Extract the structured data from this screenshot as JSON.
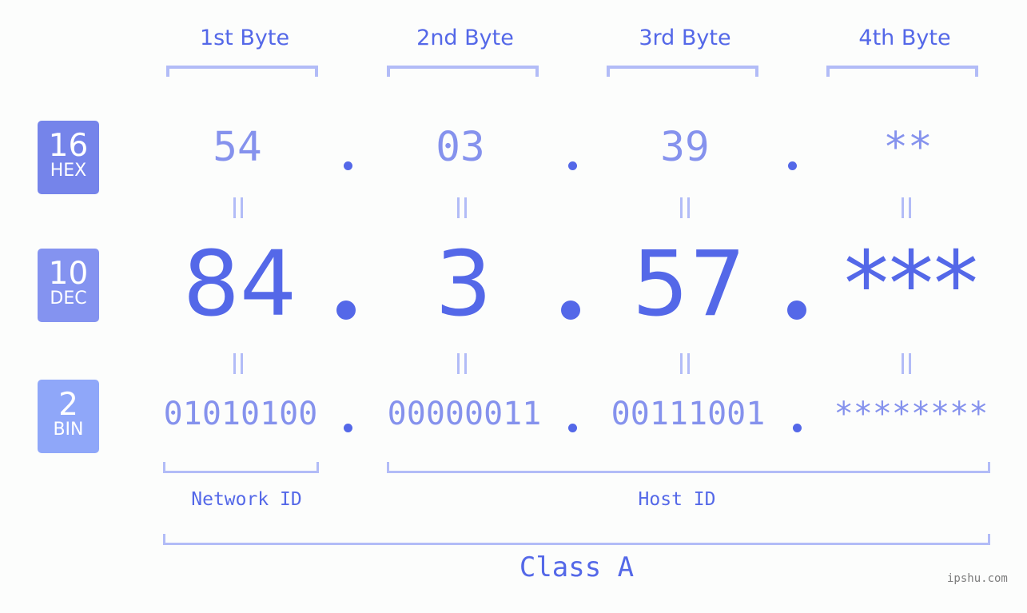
{
  "byte_headers": [
    "1st Byte",
    "2nd Byte",
    "3rd Byte",
    "4th Byte"
  ],
  "badges": [
    {
      "number": "16",
      "label": "HEX",
      "color": "#7584ea"
    },
    {
      "number": "10",
      "label": "DEC",
      "color": "#8493f0"
    },
    {
      "number": "2",
      "label": "BIN",
      "color": "#8fa7f9"
    }
  ],
  "hex": [
    "54",
    "03",
    "39",
    "**"
  ],
  "dec": [
    "84",
    "3",
    "57",
    "***"
  ],
  "bin": [
    "01010100",
    "00000011",
    "00111001",
    "********"
  ],
  "segments": {
    "network_label": "Network ID",
    "host_label": "Host ID"
  },
  "ip_class": "Class A",
  "watermark": "ipshu.com",
  "colors": {
    "accent": "#5468e8",
    "light_value": "#8592ed",
    "bracket": "#b2bcf7",
    "background": "#fcfdfc"
  }
}
